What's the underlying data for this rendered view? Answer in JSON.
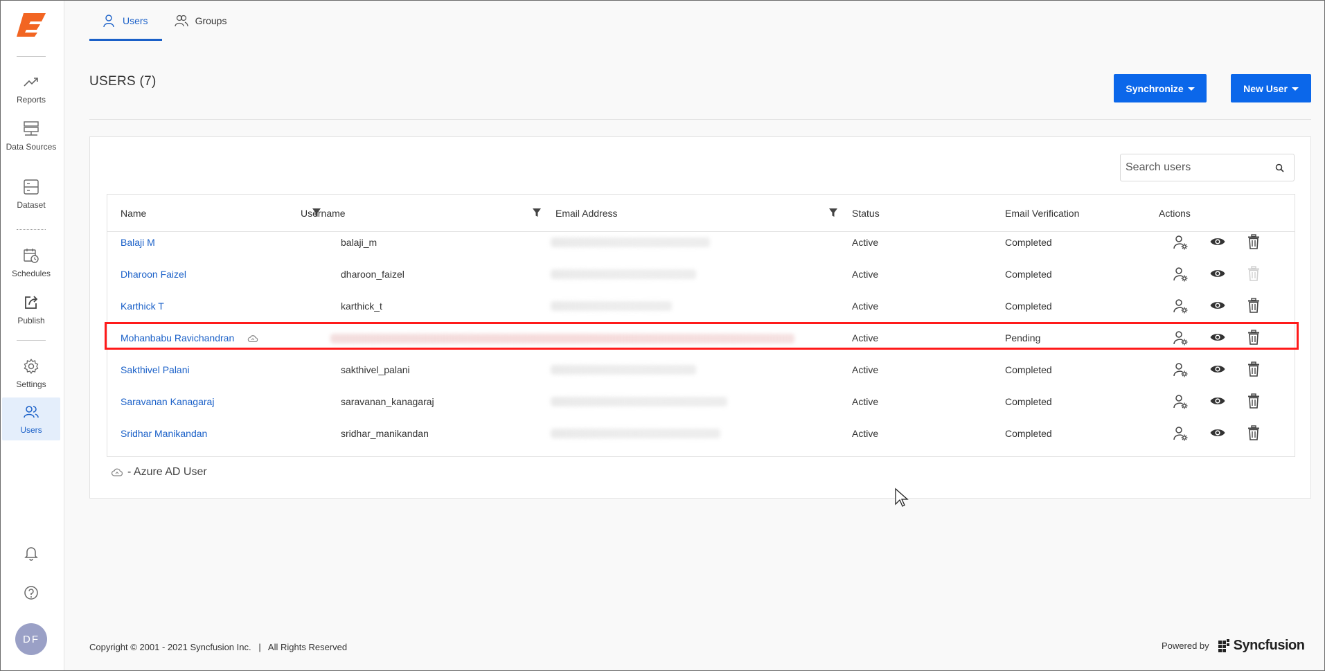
{
  "sidebar": {
    "items": [
      {
        "label": "Reports"
      },
      {
        "label": "Data Sources"
      },
      {
        "label": "Dataset"
      },
      {
        "label": "Schedules"
      },
      {
        "label": "Publish"
      },
      {
        "label": "Settings"
      },
      {
        "label": "Users",
        "active": true
      }
    ],
    "avatar_initials": "DF"
  },
  "tabs": [
    {
      "label": "Users",
      "active": true
    },
    {
      "label": "Groups"
    }
  ],
  "page": {
    "title": "USERS (7)",
    "synchronize_label": "Synchronize",
    "new_user_label": "New User"
  },
  "search": {
    "placeholder": "Search users"
  },
  "table": {
    "columns": [
      "Name",
      "Username",
      "Email Address",
      "Status",
      "Email Verification",
      "Actions"
    ],
    "rows": [
      {
        "name": "Balaji M",
        "username": "balaji_m",
        "status": "Active",
        "verification": "Completed",
        "azure": false,
        "delete_disabled": false
      },
      {
        "name": "Dharoon Faizel",
        "username": "dharoon_faizel",
        "status": "Active",
        "verification": "Completed",
        "azure": false,
        "delete_disabled": true
      },
      {
        "name": "Karthick T",
        "username": "karthick_t",
        "status": "Active",
        "verification": "Completed",
        "azure": false,
        "delete_disabled": false
      },
      {
        "name": "Mohanbabu Ravichandran",
        "username": "",
        "status": "Active",
        "verification": "Pending",
        "azure": true,
        "highlighted": true,
        "delete_disabled": false
      },
      {
        "name": "Sakthivel Palani",
        "username": "sakthivel_palani",
        "status": "Active",
        "verification": "Completed",
        "azure": false,
        "delete_disabled": false
      },
      {
        "name": "Saravanan Kanagaraj",
        "username": "saravanan_kanagaraj",
        "status": "Active",
        "verification": "Completed",
        "azure": false,
        "delete_disabled": false
      },
      {
        "name": "Sridhar Manikandan",
        "username": "sridhar_manikandan",
        "status": "Active",
        "verification": "Completed",
        "azure": false,
        "delete_disabled": false
      }
    ]
  },
  "legend": {
    "text": "- Azure AD User"
  },
  "footer": {
    "copyright": "Copyright © 2001 - 2021 Syncfusion Inc.   |   All Rights Reserved",
    "powered_by": "Powered by",
    "brand": "Syncfusion"
  },
  "colors": {
    "accent": "#0b67ea",
    "link": "#1a60c8",
    "highlight": "#ff1a1a",
    "logo": "#f26522"
  },
  "icons": {
    "reports": "trend-line-icon",
    "data_sources": "server-icon",
    "dataset": "dataset-icon",
    "schedules": "calendar-clock-icon",
    "publish": "publish-icon",
    "settings": "gear-icon",
    "users": "users-icon",
    "notifications": "bell-icon",
    "help": "help-icon",
    "azure": "cloud-icon",
    "actions": [
      "user-settings-icon",
      "eye-icon",
      "trash-icon"
    ]
  }
}
